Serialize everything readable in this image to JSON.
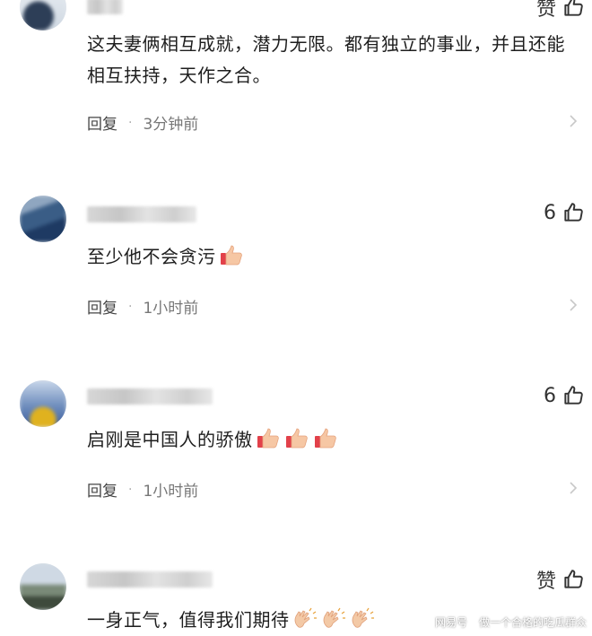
{
  "comments": [
    {
      "like_label": "赞",
      "text": "这夫妻俩相互成就，潜力无限。都有独立的事业，并且还能相互扶持，天作之合。",
      "reply_label": "回复",
      "time": "3分钟前"
    },
    {
      "like_count": "6",
      "text": "至少他不会贪污",
      "reply_label": "回复",
      "time": "1小时前"
    },
    {
      "like_count": "6",
      "text": "启刚是中国人的骄傲",
      "reply_label": "回复",
      "time": "1小时前"
    },
    {
      "like_label": "赞",
      "text": "一身正气，值得我们期待"
    }
  ],
  "watermark": {
    "source": "网易号",
    "author": "做一个合格的吃瓜群众"
  },
  "icons": {
    "like": "thumbs-up-icon",
    "more": "chevron-right-icon",
    "emoji_thumb": "thumbs-up-emoji",
    "emoji_clap": "clapping-hands-emoji"
  }
}
